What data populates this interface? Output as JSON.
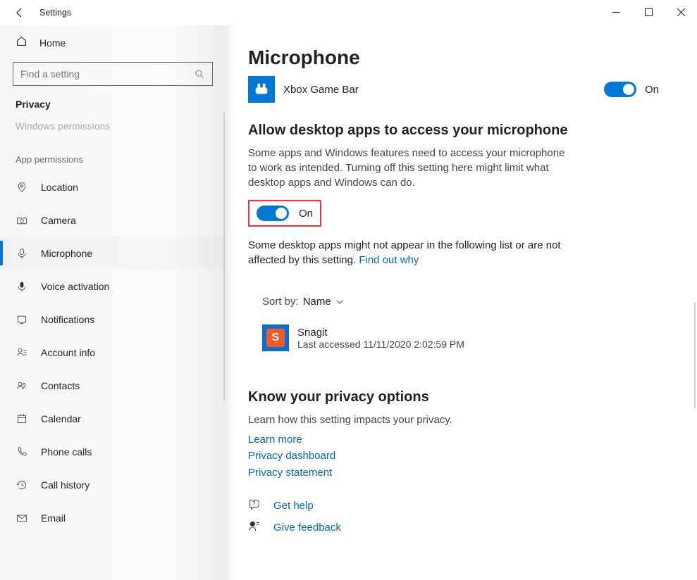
{
  "window": {
    "title": "Settings"
  },
  "sidebar": {
    "home": "Home",
    "search_placeholder": "Find a setting",
    "category": "Privacy",
    "subgroup": "Windows permissions",
    "group_header": "App permissions",
    "items": [
      {
        "label": "Location"
      },
      {
        "label": "Camera"
      },
      {
        "label": "Microphone"
      },
      {
        "label": "Voice activation"
      },
      {
        "label": "Notifications"
      },
      {
        "label": "Account info"
      },
      {
        "label": "Contacts"
      },
      {
        "label": "Calendar"
      },
      {
        "label": "Phone calls"
      },
      {
        "label": "Call history"
      },
      {
        "label": "Email"
      }
    ]
  },
  "main": {
    "page_title": "Microphone",
    "app": {
      "name": "Xbox Game Bar",
      "state": "On"
    },
    "allow": {
      "heading": "Allow desktop apps to access your microphone",
      "body": "Some apps and Windows features need to access your microphone to work as intended. Turning off this setting here might limit what desktop apps and Windows can do.",
      "state": "On",
      "info_a": "Some desktop apps might not appear in the following list or are not affected by this setting. ",
      "info_link": "Find out why"
    },
    "sort": {
      "prefix": "Sort by:",
      "value": "Name"
    },
    "desktop_app": {
      "name": "Snagit",
      "sub": "Last accessed 11/11/2020 2:02:59 PM"
    },
    "know": {
      "heading": "Know your privacy options",
      "body": "Learn how this setting impacts your privacy.",
      "links": [
        "Learn more",
        "Privacy dashboard",
        "Privacy statement"
      ]
    },
    "help": {
      "get_help": "Get help",
      "feedback": "Give feedback"
    }
  }
}
